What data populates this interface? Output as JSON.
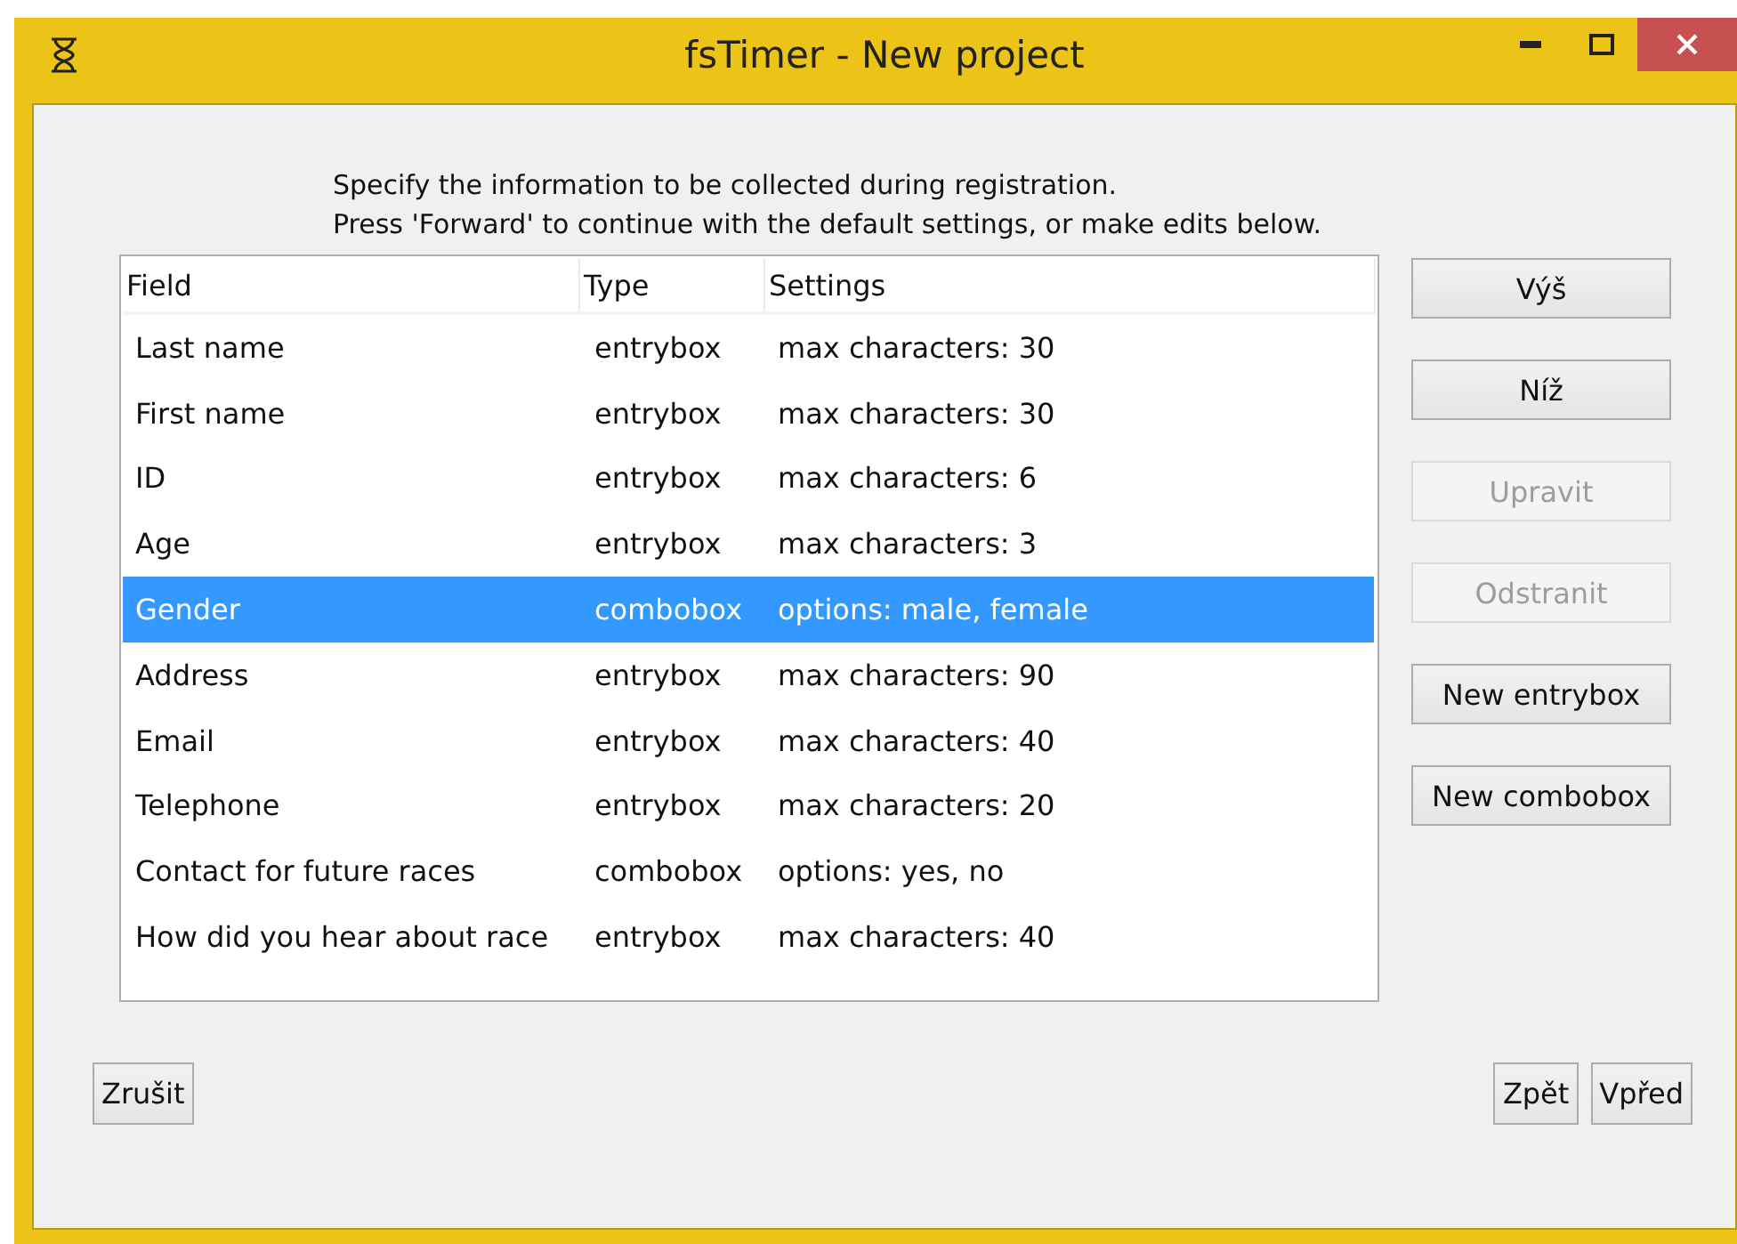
{
  "window": {
    "title": "fsTimer - New project"
  },
  "intro": [
    "Specify the information to be collected during registration.",
    "Press 'Forward' to continue with the default settings, or make edits below."
  ],
  "table": {
    "columns": [
      "Field",
      "Type",
      "Settings"
    ],
    "rows": [
      {
        "cells": [
          "Last name",
          "entrybox",
          "max characters: 30"
        ],
        "selected": false
      },
      {
        "cells": [
          "First name",
          "entrybox",
          "max characters: 30"
        ],
        "selected": false
      },
      {
        "cells": [
          "ID",
          "entrybox",
          "max characters: 6"
        ],
        "selected": false
      },
      {
        "cells": [
          "Age",
          "entrybox",
          "max characters: 3"
        ],
        "selected": false
      },
      {
        "cells": [
          "Gender",
          "combobox",
          "options: male, female"
        ],
        "selected": true
      },
      {
        "cells": [
          "Address",
          "entrybox",
          "max characters: 90"
        ],
        "selected": false
      },
      {
        "cells": [
          "Email",
          "entrybox",
          "max characters: 40"
        ],
        "selected": false
      },
      {
        "cells": [
          "Telephone",
          "entrybox",
          "max characters: 20"
        ],
        "selected": false
      },
      {
        "cells": [
          "Contact for future races",
          "combobox",
          "options: yes, no"
        ],
        "selected": false
      },
      {
        "cells": [
          "How did you hear about race",
          "entrybox",
          "max characters: 40"
        ],
        "selected": false
      }
    ]
  },
  "side_buttons": [
    {
      "label": "Výš",
      "disabled": false
    },
    {
      "label": "Níž",
      "disabled": false
    },
    {
      "label": "Upravit",
      "disabled": true
    },
    {
      "label": "Odstranit",
      "disabled": true
    },
    {
      "label": "New entrybox",
      "disabled": false
    },
    {
      "label": "New combobox",
      "disabled": false
    }
  ],
  "cancel_button": "Zrušit",
  "nav_buttons": [
    "Zpět",
    "Vpřed"
  ]
}
